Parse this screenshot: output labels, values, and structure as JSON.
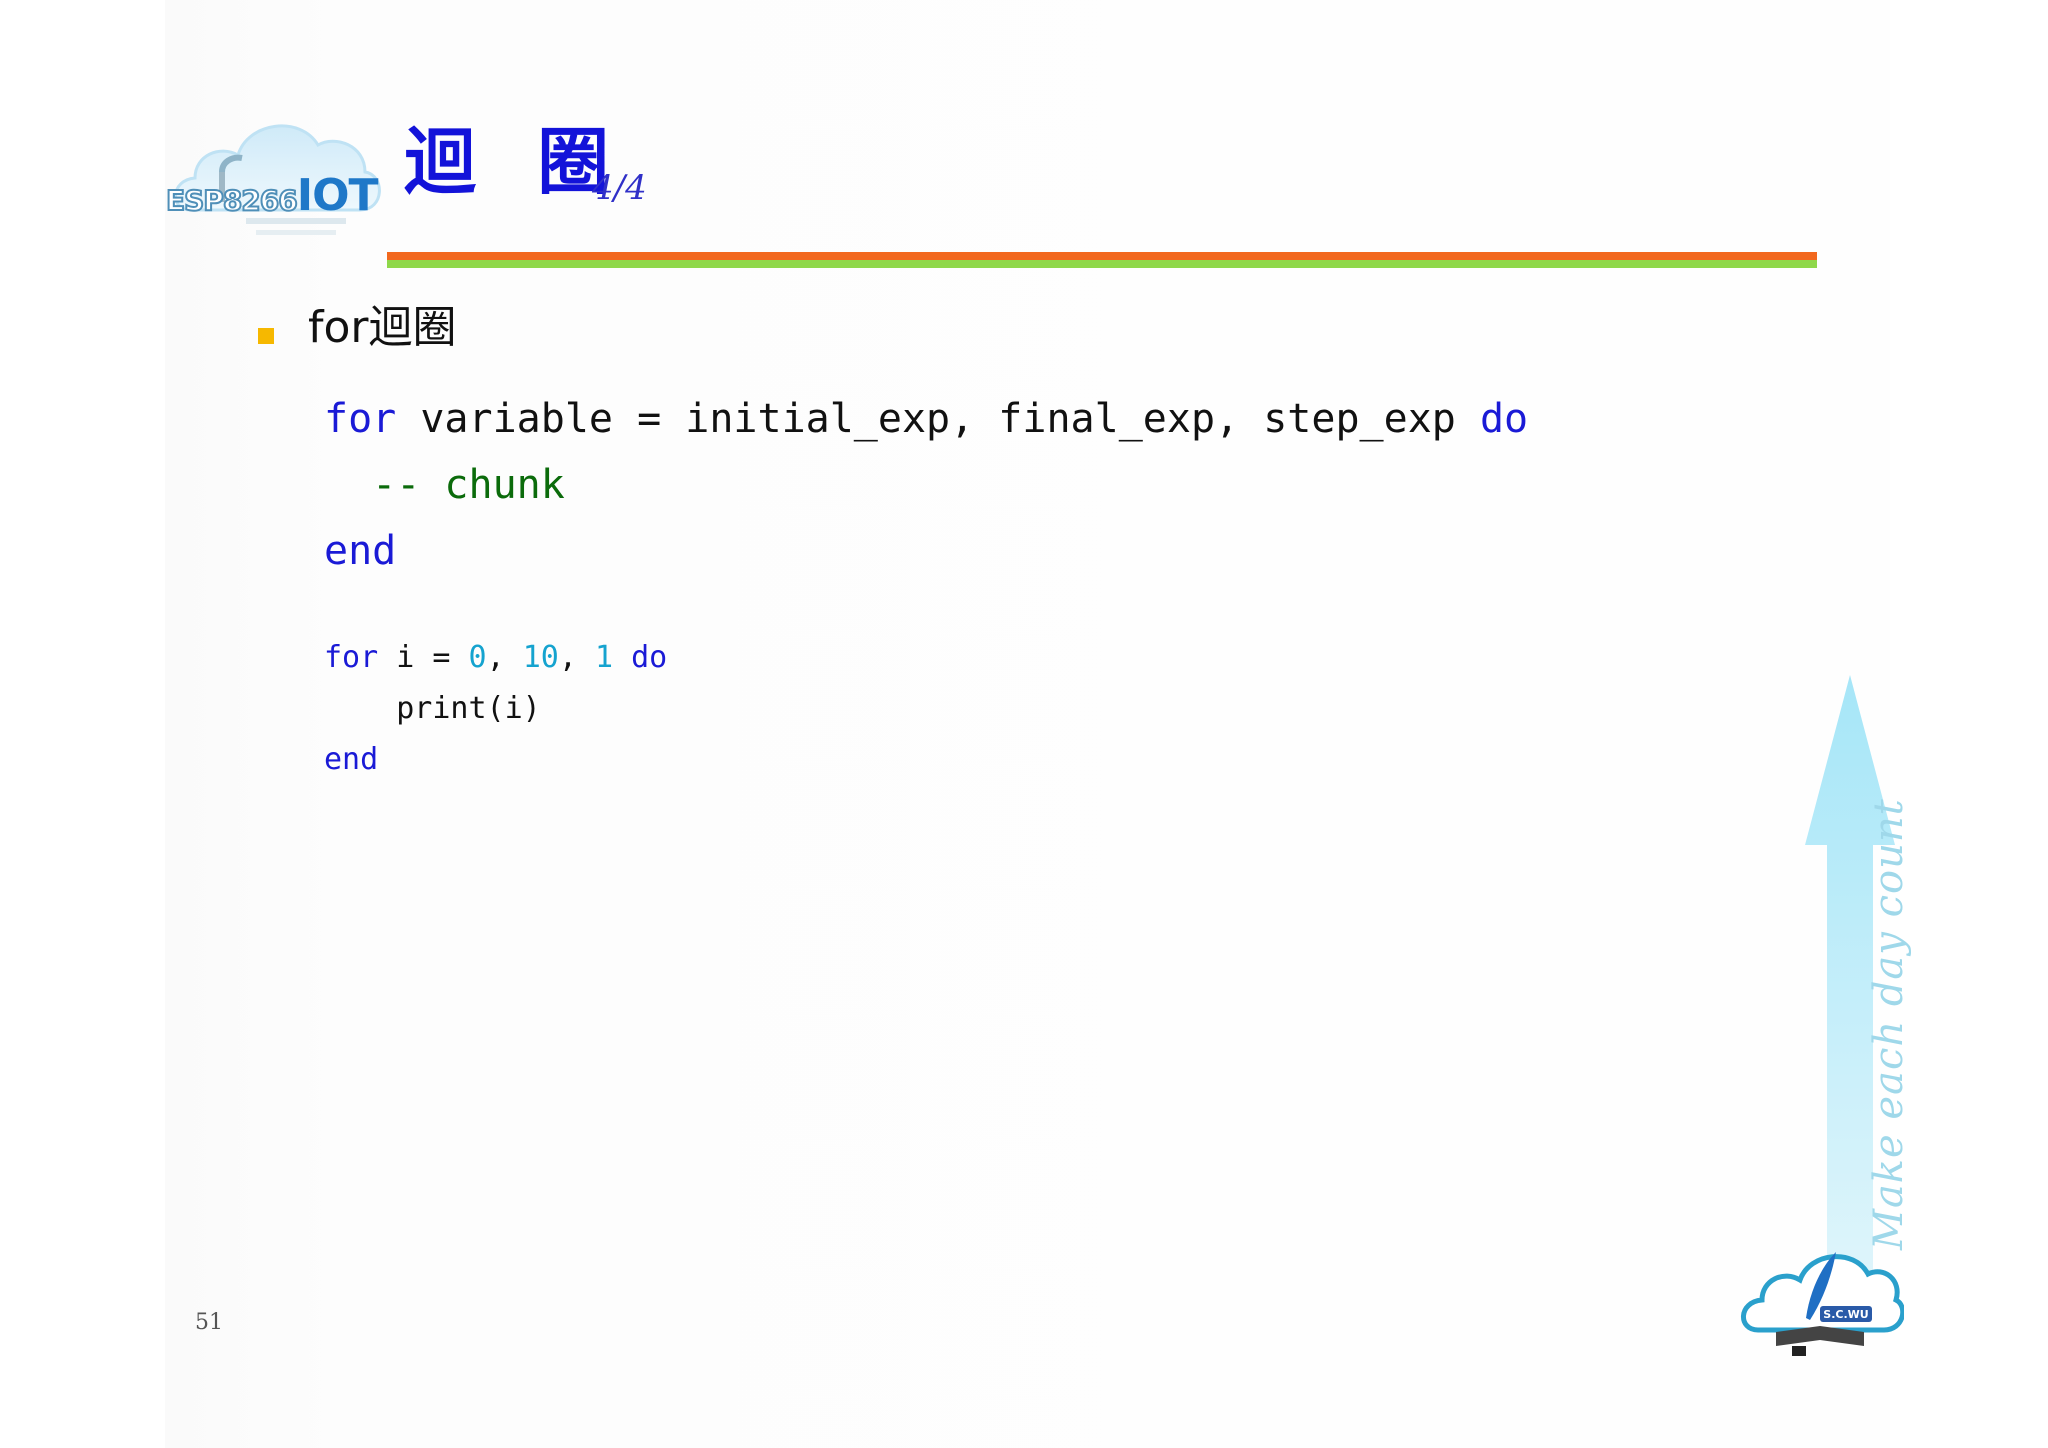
{
  "logo": {
    "esp_text": "ESP8266",
    "iot_text": "IOT"
  },
  "header": {
    "title": "迴 圈",
    "page_indicator": "4/4"
  },
  "bullet": {
    "text": "for迴圈"
  },
  "code_syntax": {
    "line1": {
      "kw_for": "for",
      "body": " variable = initial_exp, final_exp, step_exp ",
      "kw_do": "do"
    },
    "line2": {
      "indent": "  ",
      "comment": "-- chunk"
    },
    "line3": {
      "kw_end": "end"
    }
  },
  "code_example": {
    "line1": {
      "kw_for": "for",
      "t1": " i = ",
      "n1": "0",
      "t2": ", ",
      "n2": "10",
      "t3": ", ",
      "n3": "1",
      "t4": " ",
      "kw_do": "do"
    },
    "line2": {
      "text": "    print(i)"
    },
    "line3": {
      "kw_end": "end"
    }
  },
  "footer": {
    "page_number": "51",
    "motto": "Make each day count",
    "logo_text": "S.C.WU"
  },
  "colors": {
    "title": "#1313d9",
    "keyword": "#1a1ad6",
    "comment": "#0b6b0b",
    "number": "#15a3cf",
    "rule_orange": "#f2681e",
    "rule_green": "#8fd84a",
    "bullet": "#f6b800"
  }
}
